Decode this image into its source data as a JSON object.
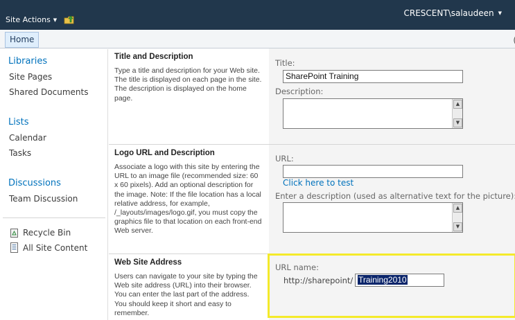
{
  "topbar": {
    "site_actions_label": "Site Actions",
    "user_label": "CRESCENT\\salaudeen"
  },
  "tabs": {
    "home_label": "Home",
    "edge_glyph": "("
  },
  "quick_launch": {
    "libraries_heading": "Libraries",
    "libraries": [
      "Site Pages",
      "Shared Documents"
    ],
    "lists_heading": "Lists",
    "lists": [
      "Calendar",
      "Tasks"
    ],
    "discussions_heading": "Discussions",
    "discussions": [
      "Team Discussion"
    ],
    "recycle_bin": "Recycle Bin",
    "all_site_content": "All Site Content"
  },
  "sections": {
    "title_desc": {
      "heading": "Title and Description",
      "text": "Type a title and description for your Web site. The title is displayed on each page in the site. The description is displayed on the home page.",
      "title_label": "Title:",
      "title_value": "SharePoint Training",
      "description_label": "Description:"
    },
    "logo": {
      "heading": "Logo URL and Description",
      "text": "Associate a logo with this site by entering the URL to an image file (recommended size: 60 x 60 pixels). Add an optional description for the image. Note: If the file location has a local relative address, for example, /_layouts/images/logo.gif, you must copy the graphics file to that location on each front-end Web server.",
      "url_label": "URL:",
      "url_value": "",
      "test_link": "Click here to test",
      "alt_label": "Enter a description (used as alternative text for the picture):"
    },
    "address": {
      "heading": "Web Site Address",
      "text": "Users can navigate to your site by typing the Web site address (URL) into their browser. You can enter the last part of the address. You should keep it short and easy to remember.",
      "url_name_label": "URL name:",
      "url_prefix": "http://sharepoint/",
      "url_name_value": "Training2010"
    }
  },
  "colors": {
    "topbar": "#21374c",
    "link": "#0072bc",
    "highlight": "#f4ea2a",
    "input_panel": "#f4f4f4"
  },
  "icons": [
    "caret-down-icon",
    "navigate-up-icon",
    "recycle-bin-icon",
    "all-site-content-icon",
    "scroll-up-icon",
    "scroll-down-icon"
  ]
}
